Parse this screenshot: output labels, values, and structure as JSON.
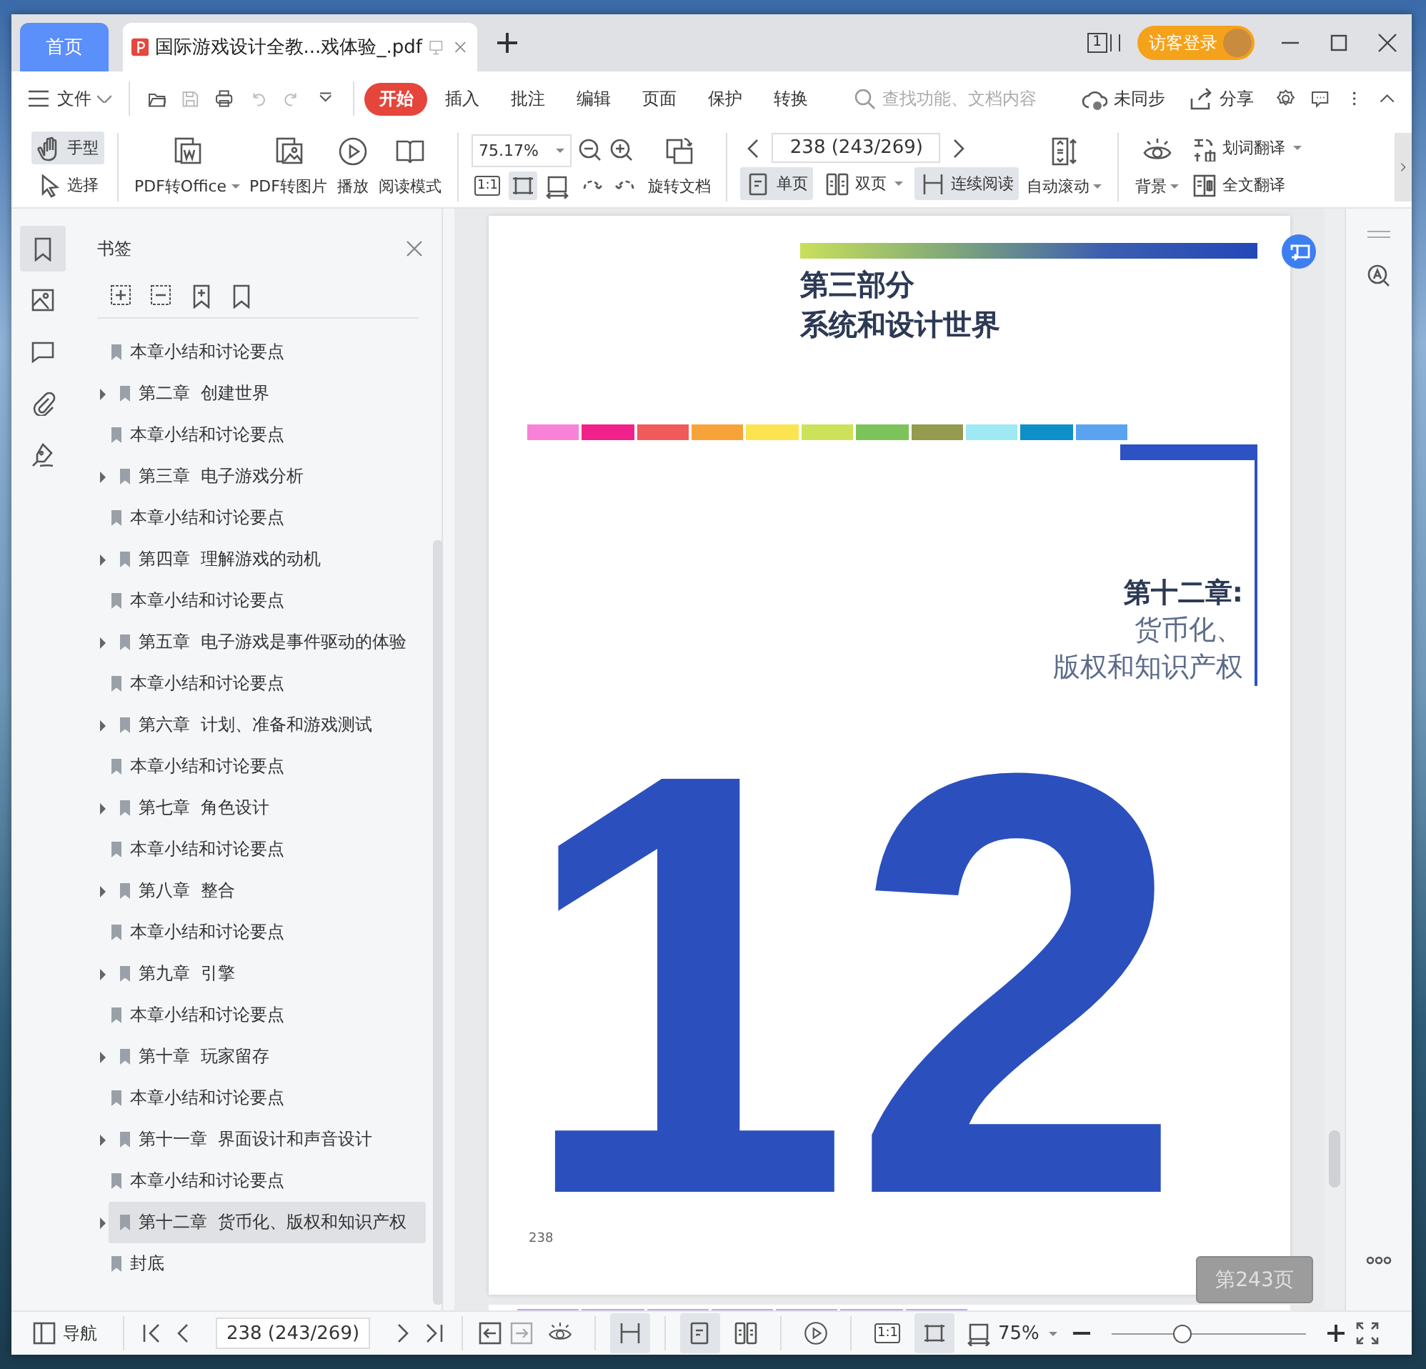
{
  "tabs": [
    {
      "label": "首页",
      "kind": "home",
      "selected": false
    },
    {
      "label": "国际游戏设计全教...戏体验_.pdf",
      "kind": "document",
      "selected": true
    }
  ],
  "title_bar": {
    "page_count_badge": "1",
    "login_button": "访客登录"
  },
  "menu": {
    "file": "文件",
    "ribbon_tabs": [
      {
        "label": "开始",
        "selected": true
      },
      {
        "label": "插入",
        "selected": false
      },
      {
        "label": "批注",
        "selected": false
      },
      {
        "label": "编辑",
        "selected": false
      },
      {
        "label": "页面",
        "selected": false
      },
      {
        "label": "保护",
        "selected": false
      },
      {
        "label": "转换",
        "selected": false
      }
    ],
    "search": {
      "placeholder": "查找功能、文档内容"
    },
    "sync": "未同步",
    "share": "分享"
  },
  "toolbar": {
    "hand_tool": {
      "label": "手型",
      "selected": true
    },
    "select_tool": {
      "label": "选择",
      "selected": false
    },
    "pdf_to_office": {
      "label": "PDF转Office",
      "dropdown": true
    },
    "pdf_to_image": {
      "label": "PDF转图片"
    },
    "play": {
      "label": "播放"
    },
    "reading_mode": {
      "label": "阅读模式"
    },
    "zoom_field": {
      "value": "75.17%"
    },
    "fit_buttons": [
      {
        "label": "1:1",
        "selected": false
      },
      {
        "selected": true
      },
      {
        "selected": false
      },
      {
        "selected": false
      },
      {
        "selected": false
      }
    ],
    "rotate": {
      "label": "旋转文档"
    },
    "page_field": {
      "value": "238 (243/269)"
    },
    "layout_buttons": [
      {
        "label": "单页",
        "selected": true
      },
      {
        "label": "双页",
        "selected": false,
        "dropdown": true
      },
      {
        "label": "连续阅读",
        "selected": true
      }
    ],
    "auto_scroll": {
      "label": "自动滚动",
      "dropdown": true
    },
    "background": {
      "label": "背景",
      "dropdown": true
    },
    "word_translate": {
      "label": "划词翻译",
      "dropdown": true
    },
    "full_translate": {
      "label": "全文翻译"
    }
  },
  "sidebar": {
    "title": "书签",
    "bookmarks": [
      {
        "label": "本章小结和讨论要点",
        "kind": "leaf",
        "selected": false
      },
      {
        "label": "第二章  创建世界",
        "kind": "branch",
        "selected": false
      },
      {
        "label": "本章小结和讨论要点",
        "kind": "leaf",
        "selected": false
      },
      {
        "label": "第三章  电子游戏分析",
        "kind": "branch",
        "selected": false
      },
      {
        "label": "本章小结和讨论要点",
        "kind": "leaf",
        "selected": false
      },
      {
        "label": "第四章  理解游戏的动机",
        "kind": "branch",
        "selected": false
      },
      {
        "label": "本章小结和讨论要点",
        "kind": "leaf",
        "selected": false
      },
      {
        "label": "第五章  电子游戏是事件驱动的体验",
        "kind": "branch",
        "selected": false
      },
      {
        "label": "本章小结和讨论要点",
        "kind": "leaf",
        "selected": false
      },
      {
        "label": "第六章  计划、准备和游戏测试",
        "kind": "branch",
        "selected": false
      },
      {
        "label": "本章小结和讨论要点",
        "kind": "leaf",
        "selected": false
      },
      {
        "label": "第七章  角色设计",
        "kind": "branch",
        "selected": false
      },
      {
        "label": "本章小结和讨论要点",
        "kind": "leaf",
        "selected": false
      },
      {
        "label": "第八章  整合",
        "kind": "branch",
        "selected": false
      },
      {
        "label": "本章小结和讨论要点",
        "kind": "leaf",
        "selected": false
      },
      {
        "label": "第九章  引擎",
        "kind": "branch",
        "selected": false
      },
      {
        "label": "本章小结和讨论要点",
        "kind": "leaf",
        "selected": false
      },
      {
        "label": "第十章  玩家留存",
        "kind": "branch",
        "selected": false
      },
      {
        "label": "本章小结和讨论要点",
        "kind": "leaf",
        "selected": false
      },
      {
        "label": "第十一章  界面设计和声音设计",
        "kind": "branch",
        "selected": false
      },
      {
        "label": "本章小结和讨论要点",
        "kind": "leaf",
        "selected": false
      },
      {
        "label": "第十二章  货币化、版权和知识产权",
        "kind": "branch",
        "selected": true
      },
      {
        "label": "封底",
        "kind": "leaf",
        "selected": false
      }
    ]
  },
  "page": {
    "part_label": "第三部分",
    "part_title": "系统和设计世界",
    "chapter_label": "第十二章:",
    "chapter_title": [
      "货币化、",
      "版权和知识产权"
    ],
    "chapter_number": "12",
    "page_number": "238"
  },
  "page_badge": "第243页",
  "status_bar": {
    "navigation": "导航",
    "page_field": "238 (243/269)",
    "view_buttons": [
      {
        "selected": false
      },
      {
        "selected": true
      },
      {
        "selected": true
      },
      {
        "selected": false
      },
      {
        "selected": false
      },
      {
        "label": "1:1",
        "selected": false
      },
      {
        "selected": true
      }
    ],
    "zoom": "75%",
    "zoom_slider": {
      "level": 0.36
    }
  }
}
